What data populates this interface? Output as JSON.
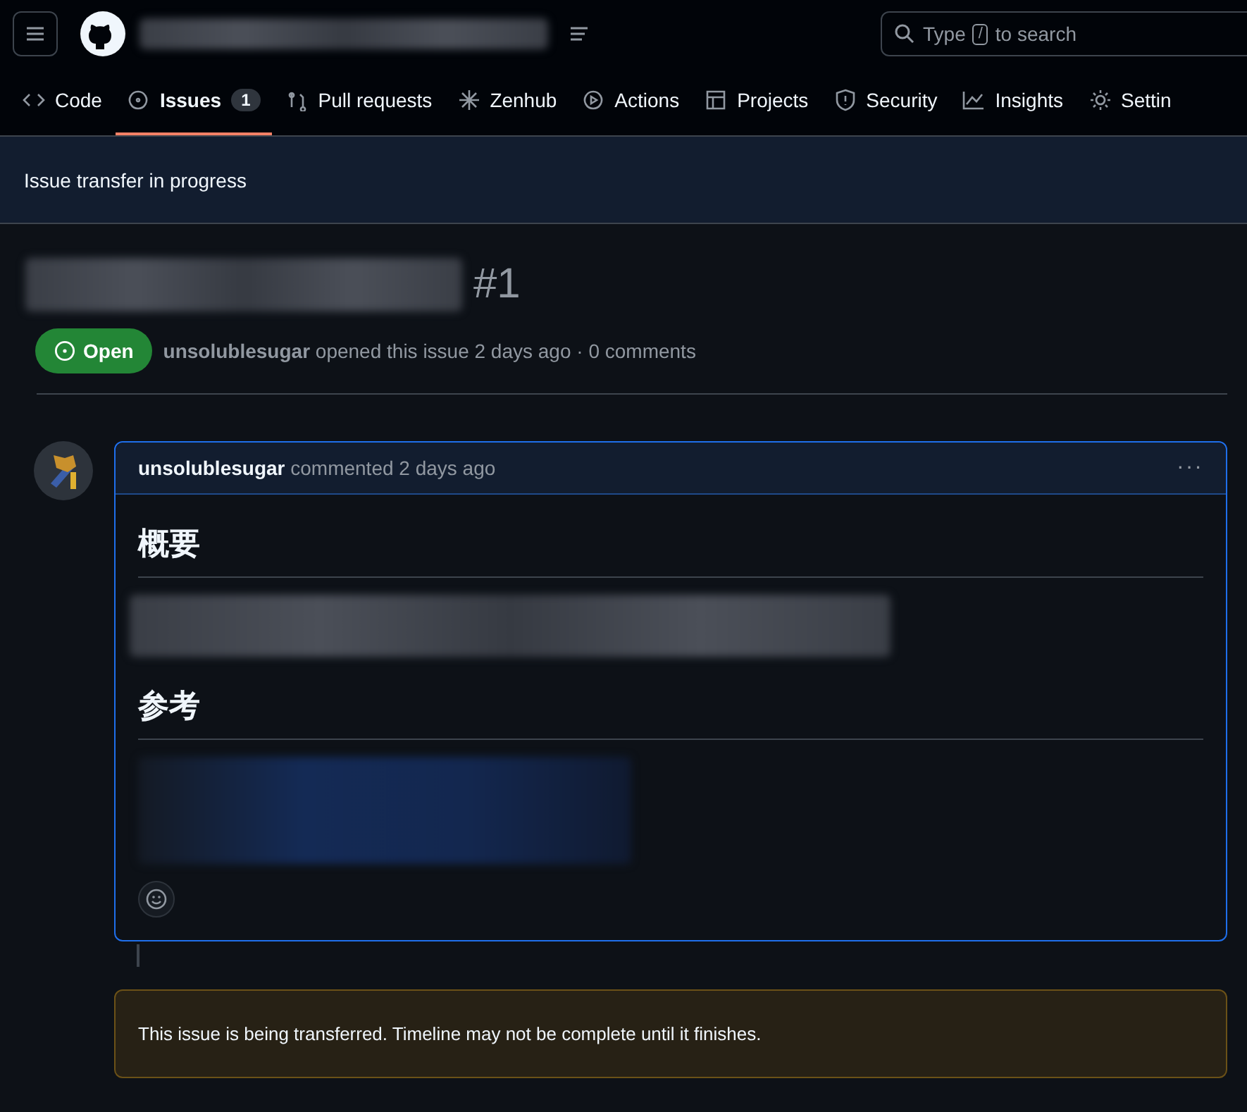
{
  "header": {
    "search": {
      "placeholder_before": "Type",
      "placeholder_key": "/",
      "placeholder_after": "to search"
    }
  },
  "tabs": [
    {
      "label": "Code",
      "selected": false
    },
    {
      "label": "Issues",
      "selected": true,
      "counter": "1"
    },
    {
      "label": "Pull requests",
      "selected": false
    },
    {
      "label": "Zenhub",
      "selected": false
    },
    {
      "label": "Actions",
      "selected": false
    },
    {
      "label": "Projects",
      "selected": false
    },
    {
      "label": "Security",
      "selected": false
    },
    {
      "label": "Insights",
      "selected": false
    },
    {
      "label": "Settin",
      "selected": false
    }
  ],
  "banner": "Issue transfer in progress",
  "issue": {
    "number": "#1",
    "state": "Open",
    "author": "unsolublesugar",
    "meta": "opened this issue 2 days ago · 0 comments"
  },
  "comment": {
    "author": "unsolublesugar",
    "meta": "commented 2 days ago",
    "menu": "···",
    "body": [
      {
        "kind": "heading",
        "text": "概要"
      },
      {
        "kind": "redacted"
      },
      {
        "kind": "heading",
        "text": "参考"
      },
      {
        "kind": "redacted-link"
      }
    ]
  },
  "notice": "This issue is being transferred. Timeline may not be complete until it finishes."
}
